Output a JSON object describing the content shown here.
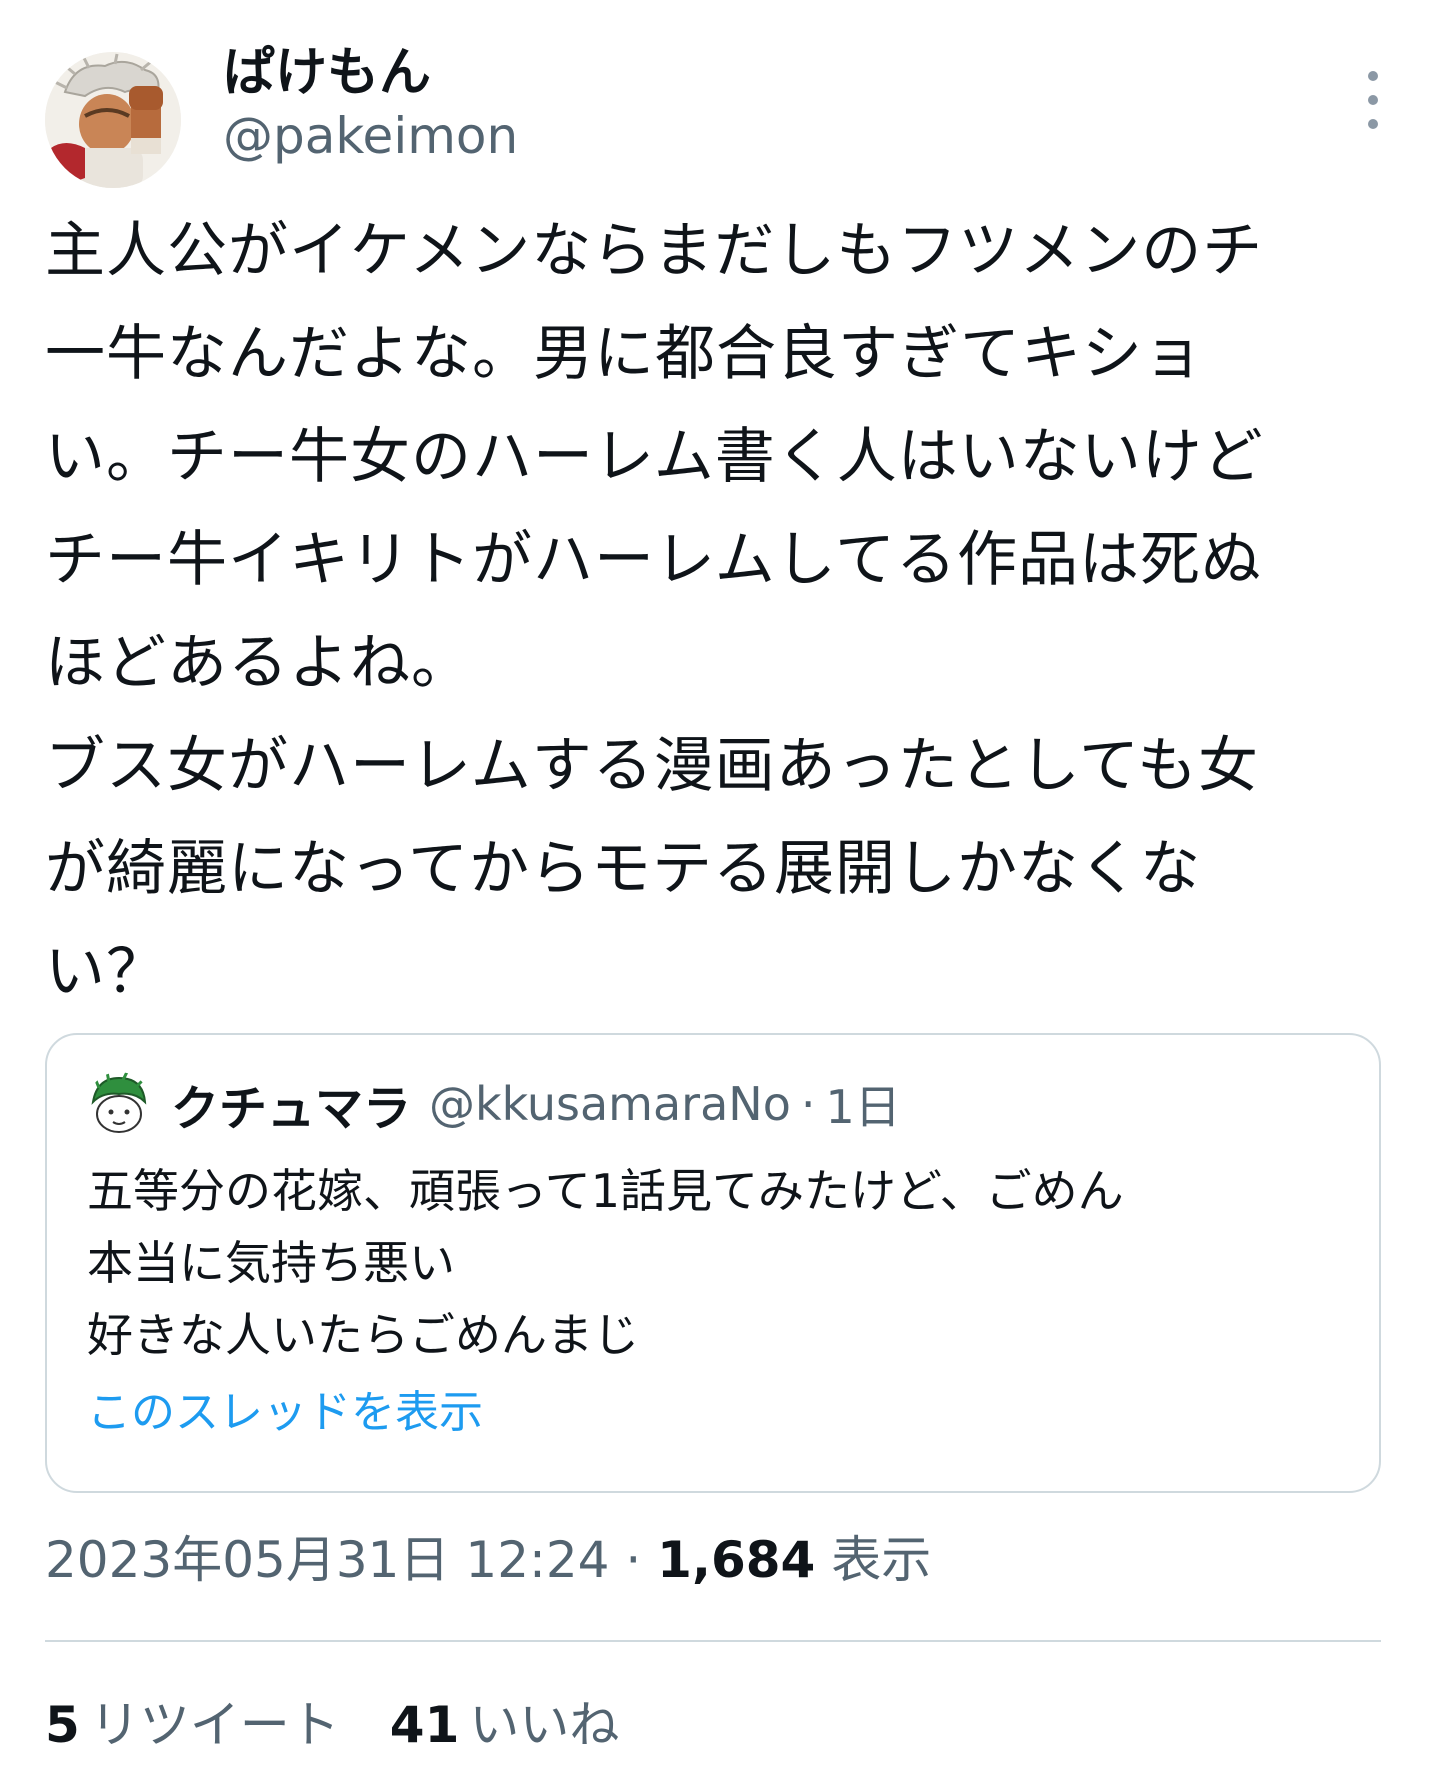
{
  "author": {
    "display_name": "ぱけもん",
    "handle": "@pakeimon"
  },
  "tweet": {
    "text": "主人公がイケメンならまだしもフツメンのチ\n一牛なんだよな。男に都合良すぎてキショ\nい。チー牛女のハーレム書く人はいないけど\nチー牛イキリトがハーレムしてる作品は死ぬ\nほどあるよね。\nブス女がハーレムする漫画あったとしても女\nが綺麗になってからモテる展開しかなくな\nい？"
  },
  "quote": {
    "display_name": "クチュマラ",
    "handle": "@kkusamaraNo",
    "separator": "·",
    "time": "1日",
    "text": "五等分の花嫁、頑張って1話見てみたけど、ごめん\n本当に気持ち悪い\n好きな人いたらごめんまじ",
    "show_thread": "このスレッドを表示"
  },
  "meta": {
    "timestamp": "2023年05月31日 12:24",
    "separator": " · ",
    "views_count": "1,684",
    "views_label": "表示"
  },
  "stats": {
    "retweets_count": "5",
    "retweets_label": "リツイート",
    "likes_count": "41",
    "likes_label": "いいね"
  },
  "colors": {
    "text": "#0f1419",
    "secondary": "#536471",
    "link": "#1d9bf0",
    "border": "#cfd9de"
  },
  "icons": {
    "more": "more-vertical-icon",
    "avatar": "user-avatar",
    "quote_avatar": "quoted-user-avatar"
  }
}
